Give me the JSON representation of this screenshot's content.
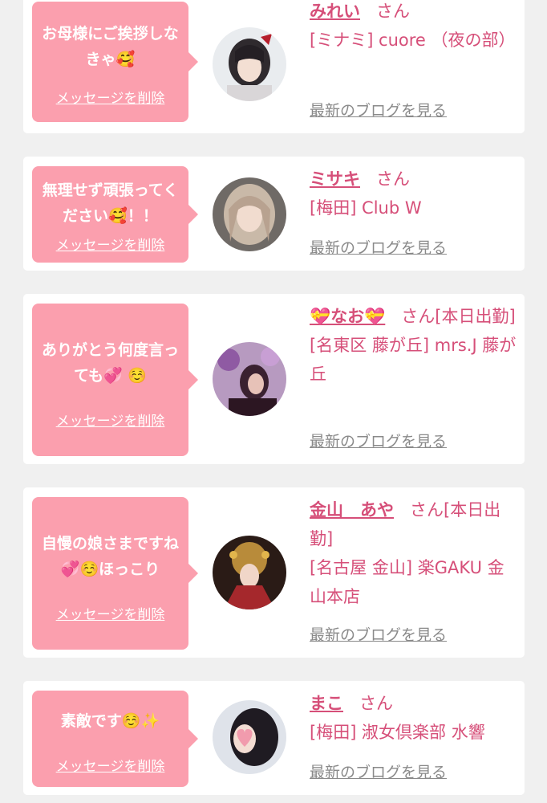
{
  "colors": {
    "background": "#f0f0f0",
    "card": "#ffffff",
    "bubble": "#fb9fae",
    "name": "#d64f79",
    "blog_link": "#8a8a8a"
  },
  "entries": [
    {
      "message": "お母様にご挨拶しなきゃ🥰",
      "delete_label": "メッセージを削除",
      "name": "みれい",
      "suffix": "さん",
      "shop": "[ミナミ] cuore （夜の部）",
      "blog_label": "最新のブログを見る"
    },
    {
      "message": "無理せず頑張ってください🥰！！",
      "delete_label": "メッセージを削除",
      "name": "ミサキ",
      "suffix": "さん",
      "shop": "[梅田] Club W",
      "blog_label": "最新のブログを見る"
    },
    {
      "message": "ありがとう何度言っても💞 ☺️",
      "delete_label": "メッセージを削除",
      "name": "💝なお💝",
      "suffix": "さん[本日出勤]",
      "shop": "[名東区 藤が丘] mrs.J 藤が丘",
      "blog_label": "最新のブログを見る"
    },
    {
      "message": "自慢の娘さまですね💞☺️ほっこり",
      "delete_label": "メッセージを削除",
      "name": "金山　あや",
      "suffix": "さん[本日出勤]",
      "shop": "[名古屋 金山] 楽GAKU 金山本店",
      "blog_label": "最新のブログを見る"
    },
    {
      "message": "素敵です☺️✨",
      "delete_label": "メッセージを削除",
      "name": "まこ",
      "suffix": "さん",
      "shop": "[梅田] 淑女倶楽部 水響",
      "blog_label": "最新のブログを見る"
    }
  ]
}
